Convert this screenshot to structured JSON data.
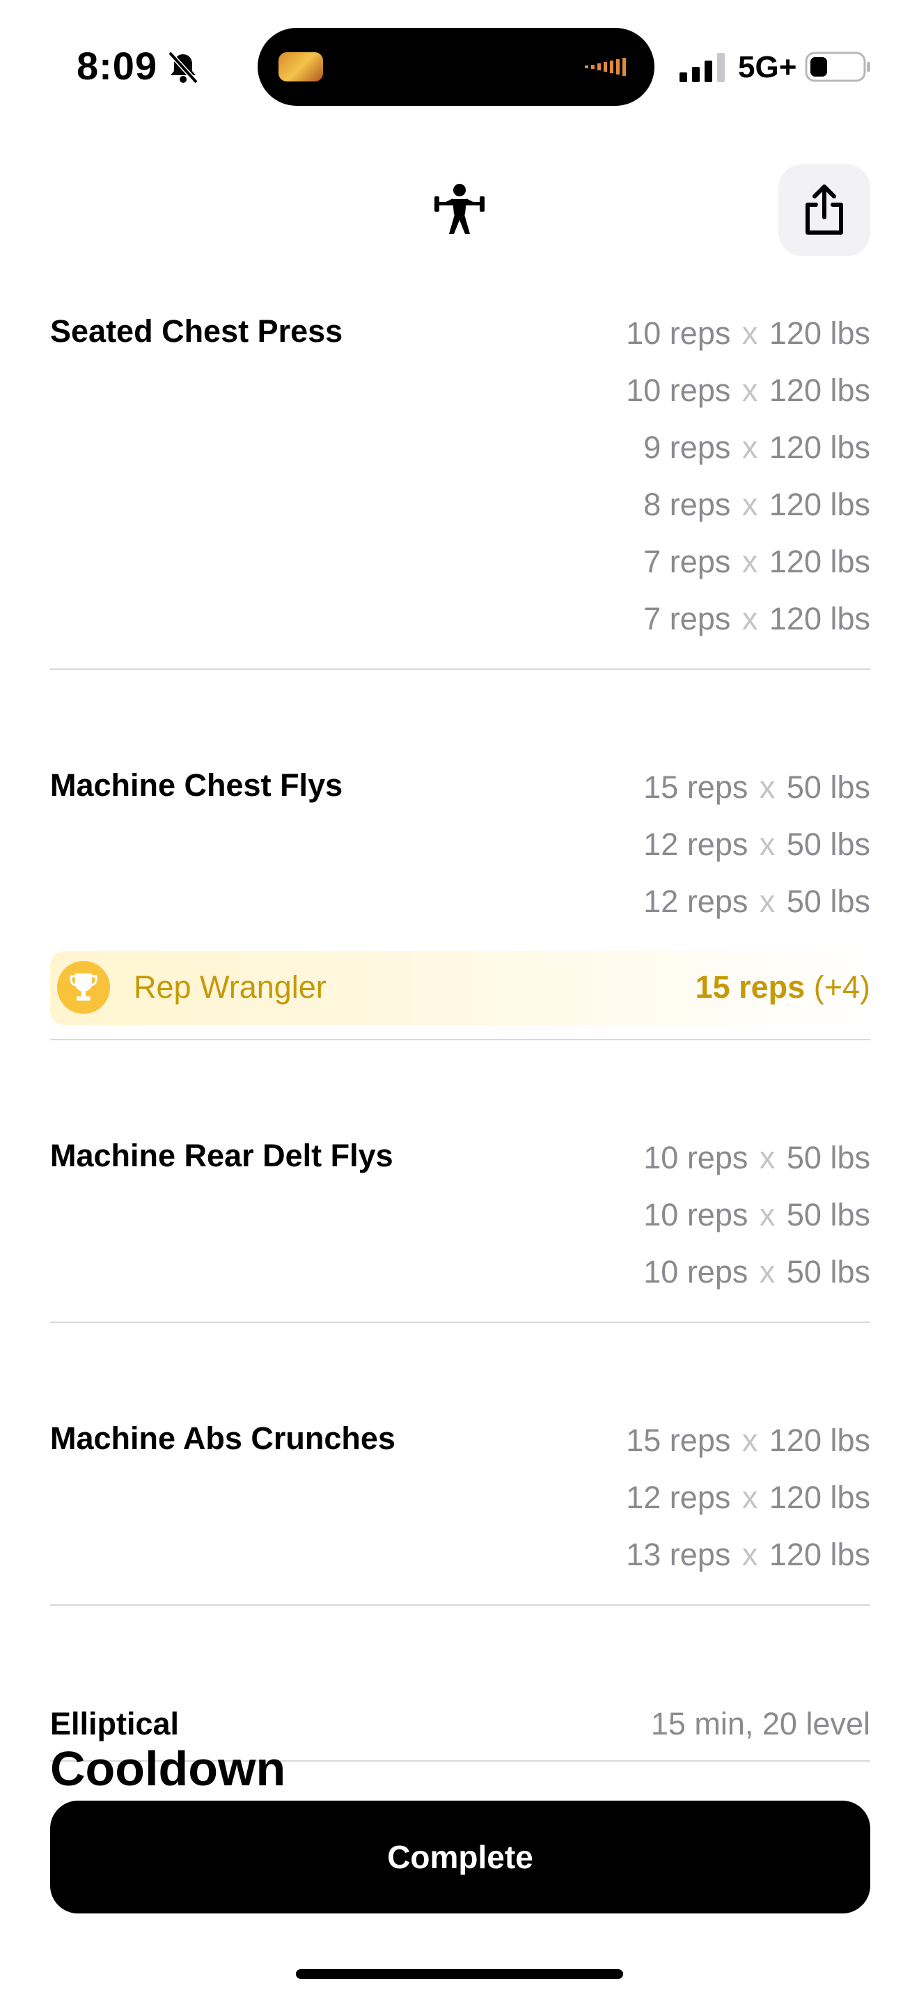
{
  "status_bar": {
    "time": "8:09",
    "network": "5G+"
  },
  "header": {
    "share_label": "Share"
  },
  "exercises": [
    {
      "name": "Seated Chest Press",
      "sets": [
        {
          "reps": "10 reps",
          "weight": "120 lbs"
        },
        {
          "reps": "10 reps",
          "weight": "120 lbs"
        },
        {
          "reps": "9 reps",
          "weight": "120 lbs"
        },
        {
          "reps": "8 reps",
          "weight": "120 lbs"
        },
        {
          "reps": "7 reps",
          "weight": "120 lbs"
        },
        {
          "reps": "7 reps",
          "weight": "120 lbs"
        }
      ]
    },
    {
      "name": "Machine Chest Flys",
      "sets": [
        {
          "reps": "15 reps",
          "weight": "50 lbs"
        },
        {
          "reps": "12 reps",
          "weight": "50 lbs"
        },
        {
          "reps": "12 reps",
          "weight": "50 lbs"
        }
      ],
      "achievement": {
        "title": "Rep Wrangler",
        "value": "15 reps",
        "delta": "(+4)"
      }
    },
    {
      "name": "Machine Rear Delt Flys",
      "sets": [
        {
          "reps": "10 reps",
          "weight": "50 lbs"
        },
        {
          "reps": "10 reps",
          "weight": "50 lbs"
        },
        {
          "reps": "10 reps",
          "weight": "50 lbs"
        }
      ]
    },
    {
      "name": "Machine Abs Crunches",
      "sets": [
        {
          "reps": "15 reps",
          "weight": "120 lbs"
        },
        {
          "reps": "12 reps",
          "weight": "120 lbs"
        },
        {
          "reps": "13 reps",
          "weight": "120 lbs"
        }
      ]
    },
    {
      "name": "Elliptical",
      "summary": "15 min, 20 level"
    }
  ],
  "separator": "x",
  "section_title": "Cooldown",
  "complete_label": "Complete",
  "colors": {
    "accent_gold": "#c59a08",
    "trophy": "#f8c33a",
    "muted": "#8a8a90"
  }
}
